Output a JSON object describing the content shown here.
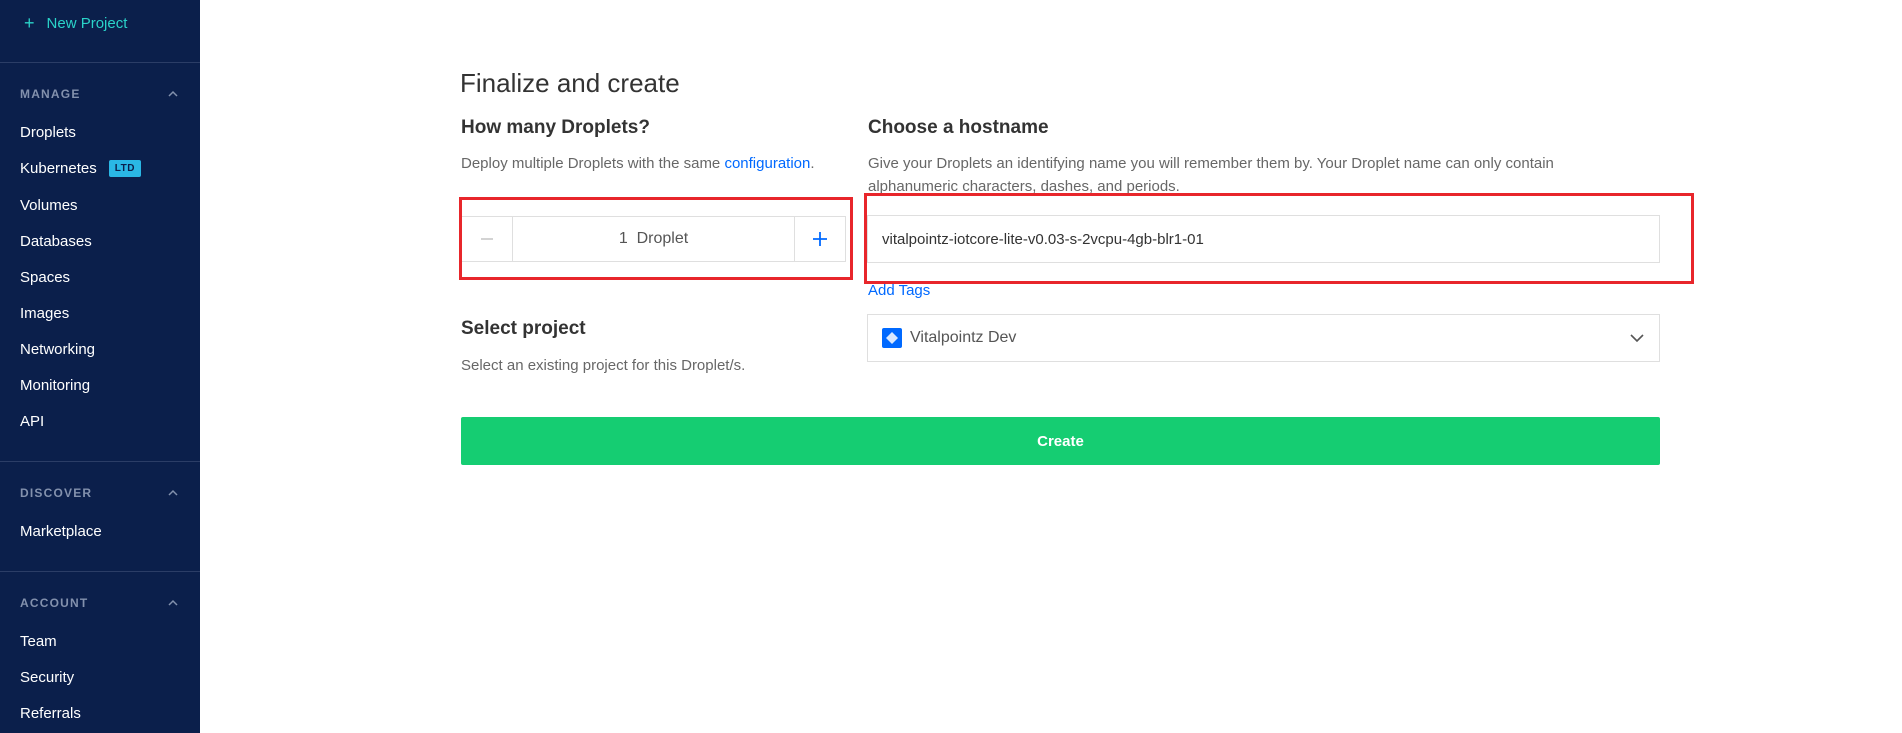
{
  "sidebar": {
    "new_project": "New Project",
    "sections": {
      "manage": "MANAGE",
      "discover": "DISCOVER",
      "account": "ACCOUNT"
    },
    "manage_items": [
      "Droplets",
      "Kubernetes",
      "Volumes",
      "Databases",
      "Spaces",
      "Images",
      "Networking",
      "Monitoring",
      "API"
    ],
    "kubernetes_badge": "LTD",
    "discover_items": [
      "Marketplace"
    ],
    "account_items": [
      "Team",
      "Security",
      "Referrals"
    ]
  },
  "main": {
    "title": "Finalize and create",
    "droplets": {
      "heading": "How many Droplets?",
      "desc_prefix": "Deploy multiple Droplets with the same ",
      "desc_link": "configuration",
      "desc_suffix": ".",
      "count": "1",
      "unit": "Droplet"
    },
    "hostname": {
      "heading": "Choose a hostname",
      "desc": "Give your Droplets an identifying name you will remember them by. Your Droplet name can only contain alphanumeric characters, dashes, and periods.",
      "value": "vitalpointz-iotcore-lite-v0.03-s-2vcpu-4gb-blr1-01",
      "add_tags": "Add Tags"
    },
    "project": {
      "heading": "Select project",
      "desc": "Select an existing project for this Droplet/s.",
      "selected": "Vitalpointz Dev"
    },
    "create_label": "Create"
  },
  "colors": {
    "sidebar_bg": "#0b1f4b",
    "accent_teal": "#2ad3c9",
    "link_blue": "#0069ff",
    "create_green": "#15cd72",
    "highlight_red": "#e8262b"
  }
}
